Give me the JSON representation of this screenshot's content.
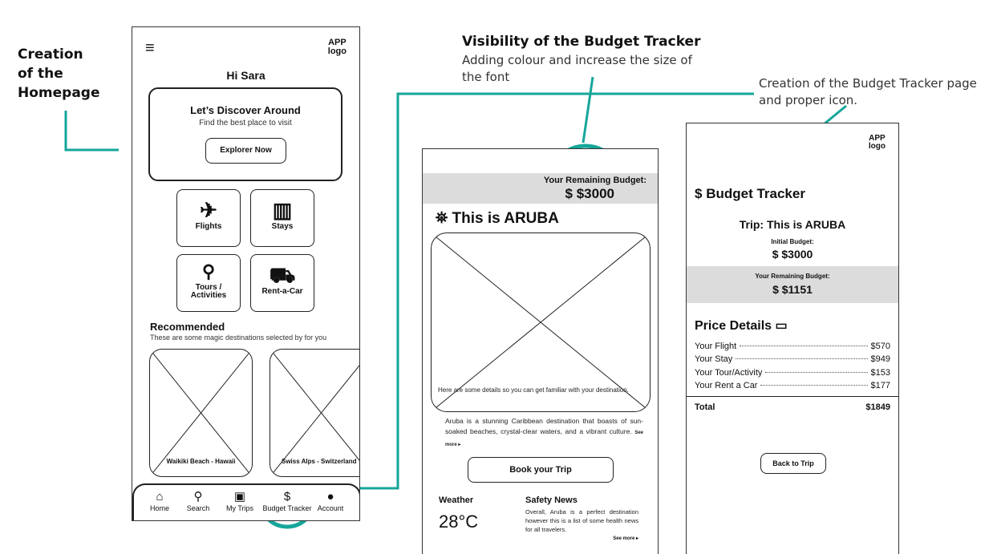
{
  "annotations": {
    "homepage_title": "Creation\nof the\nHomepage",
    "visibility_title": "Visibility of the Budget Tracker",
    "visibility_desc": "Adding colour and increase the size of the font",
    "budget_page_desc": "Creation of the Budget Tracker page and proper icon.",
    "accent_color": "#16a69a"
  },
  "home": {
    "logo": "APP\nlogo",
    "menu_icon": "hamburger-icon",
    "greeting": "Hi Sara",
    "discover_title": "Let’s Discover Around",
    "discover_sub": "Find the best place to visit",
    "explore_button": "Explorer Now",
    "categories": [
      {
        "label": "Flights",
        "icon": "plane-icon",
        "glyph": "✈"
      },
      {
        "label": "Stays",
        "icon": "hotel-icon",
        "glyph": "🏨"
      },
      {
        "label": "Tours /\nActivities",
        "icon": "map-pin-icon",
        "glyph": "📍"
      },
      {
        "label": "Rent-a-Car",
        "icon": "car-icon",
        "glyph": "🚗"
      }
    ],
    "recommended_title": "Recommended",
    "recommended_sub": "These are some magic destinations selected by for you",
    "destinations": [
      "Waikiki Beach - Hawaii",
      "Swiss Alps - Switzerland"
    ],
    "nav": [
      {
        "label": "Home",
        "icon": "home-icon",
        "glyph": "⌂"
      },
      {
        "label": "Search",
        "icon": "search-icon",
        "glyph": "⚲"
      },
      {
        "label": "My Trips",
        "icon": "suitcase-icon",
        "glyph": "▣"
      },
      {
        "label": "Budget Tracker",
        "icon": "money-bag-icon",
        "glyph": "$"
      },
      {
        "label": "Account",
        "icon": "user-icon",
        "glyph": "●"
      }
    ]
  },
  "trip": {
    "remaining_label": "Your Remaining Budget:",
    "remaining_value": "$3000",
    "title": "This is ARUBA",
    "image_caption": "Here are some details so you can get familiar with your destination.",
    "description": "Aruba is a stunning Caribbean destination that boasts of sun-soaked beaches, crystal-clear waters, and a vibrant culture.",
    "see_more": "See more ▸",
    "book_button": "Book your Trip",
    "weather_label": "Weather",
    "weather_value": "28°C",
    "safety_title": "Safety News",
    "safety_text": "Overall, Aruba is a perfect destination however this is a list of some health news for all travelers.",
    "safety_more": "See more ▸"
  },
  "budget": {
    "logo": "APP\nlogo",
    "title": "Budget Tracker",
    "trip_title": "Trip: This is ARUBA",
    "initial_label": "Initial Budget:",
    "initial_value": "$3000",
    "remaining_label": "Your Remaining Budget:",
    "remaining_value": "$1151",
    "price_title": "Price Details",
    "items": [
      {
        "label": "Your Flight",
        "value": "$570"
      },
      {
        "label": "Your Stay",
        "value": "$949"
      },
      {
        "label": "Your Tour/Activity",
        "value": "$153"
      },
      {
        "label": "Your Rent a Car",
        "value": "$177"
      }
    ],
    "total_label": "Total",
    "total_value": "$1849",
    "back_button": "Back to Trip"
  }
}
